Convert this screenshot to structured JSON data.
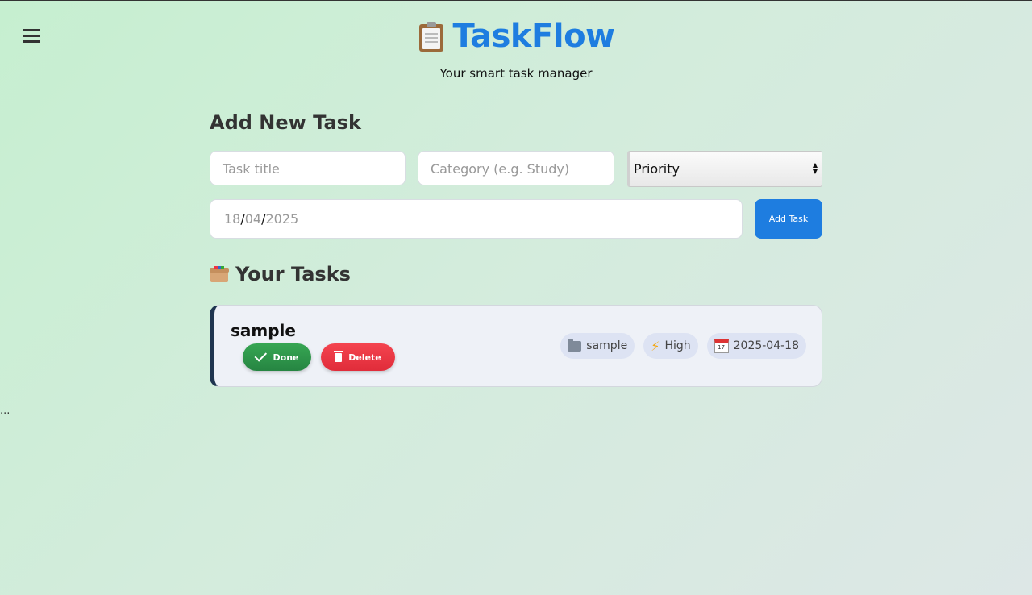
{
  "header": {
    "title": "TaskFlow",
    "subtitle": "Your smart task manager",
    "logo_icon": "clipboard-icon"
  },
  "form": {
    "heading": "Add New Task",
    "title_placeholder": "Task title",
    "category_placeholder": "Category (e.g. Study)",
    "priority_selected": "Priority",
    "date_day": "18",
    "date_month": "04",
    "date_year": "2025",
    "add_button": "Add Task"
  },
  "tasks": {
    "heading": "Your Tasks",
    "heading_icon": "box-icon",
    "items": [
      {
        "title": "sample",
        "done_label": "Done",
        "delete_label": "Delete",
        "category": "sample",
        "priority": "High",
        "due_date": "2025-04-18"
      }
    ]
  },
  "misc": {
    "ellipsis": "..."
  },
  "colors": {
    "accent": "#1e7de0",
    "done": "#2f9a4a",
    "delete": "#ea3541",
    "card_border": "#1f3550"
  }
}
